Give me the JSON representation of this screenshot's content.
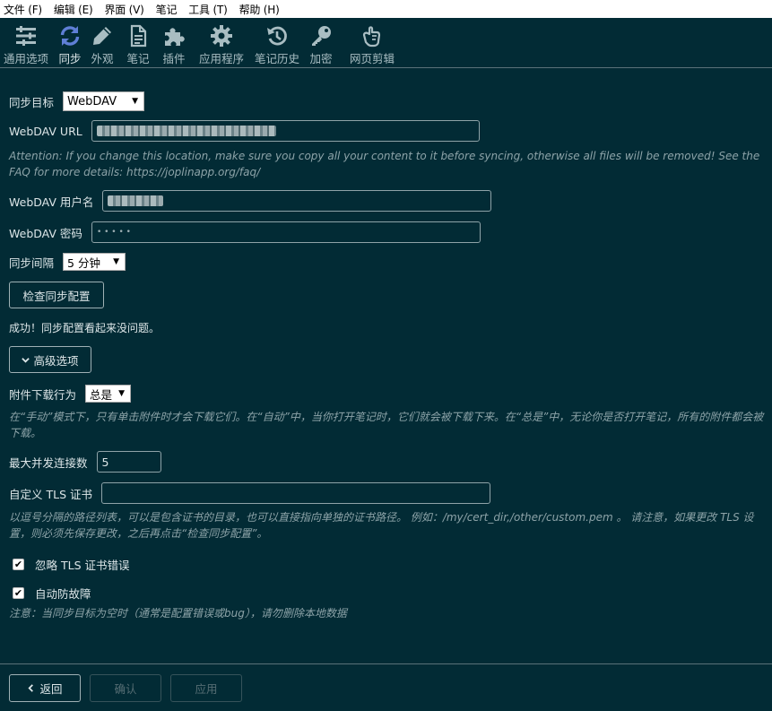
{
  "menu": [
    "文件 (F)",
    "编辑 (E)",
    "界面 (V)",
    "笔记",
    "工具 (T)",
    "帮助 (H)"
  ],
  "toolbar": [
    {
      "label": "通用选项",
      "icon": "sliders-icon",
      "active": false
    },
    {
      "label": "同步",
      "icon": "sync-icon",
      "active": true
    },
    {
      "label": "外观",
      "icon": "pencil-icon",
      "active": false
    },
    {
      "label": "笔记",
      "icon": "document-icon",
      "active": false
    },
    {
      "label": "插件",
      "icon": "puzzle-icon",
      "active": false
    },
    {
      "label": "应用程序",
      "icon": "gear-icon",
      "active": false
    },
    {
      "label": "笔记历史",
      "icon": "history-icon",
      "active": false
    },
    {
      "label": "加密",
      "icon": "key-icon",
      "active": false
    },
    {
      "label": "网页剪辑",
      "icon": "hand-icon",
      "active": false
    }
  ],
  "sync": {
    "target_label": "同步目标",
    "target_value": "WebDAV",
    "url_label": "WebDAV URL",
    "attention": "Attention: If you change this location, make sure you copy all your content to it before syncing, otherwise all files will be removed! See the FAQ for more details: https://joplinapp.org/faq/",
    "username_label": "WebDAV 用户名",
    "password_label": "WebDAV 密码",
    "password_mask": "• • • • •",
    "interval_label": "同步间隔",
    "interval_value": "5 分钟",
    "check_button": "检查同步配置",
    "check_result": "成功！同步配置看起来没问题。",
    "advanced_button": "高级选项"
  },
  "advanced": {
    "attach_label": "附件下载行为",
    "attach_value": "总是",
    "attach_hint": "在“手动”模式下，只有单击附件时才会下载它们。在“自动”中，当你打开笔记时，它们就会被下载下来。在“总是”中，无论你是否打开笔记，所有的附件都会被下载。",
    "max_conn_label": "最大并发连接数",
    "max_conn_value": "5",
    "tls_label": "自定义 TLS 证书",
    "tls_value": "",
    "tls_hint": "以逗号分隔的路径列表，可以是包含证书的目录，也可以直接指向单独的证书路径。 例如：/my/cert_dir,/other/custom.pem 。 请注意，如果更改 TLS 设置，则必须先保存更改，之后再点击“检查同步配置”。",
    "ignore_tls_label": "忽略 TLS 证书错误",
    "ignore_tls_checked": true,
    "failsafe_label": "自动防故障",
    "failsafe_checked": true,
    "failsafe_hint": "注意：当同步目标为空时（通常是配置错误或bug），请勿删除本地数据"
  },
  "footer": {
    "back": "返回",
    "ok": "确认",
    "apply": "应用"
  }
}
